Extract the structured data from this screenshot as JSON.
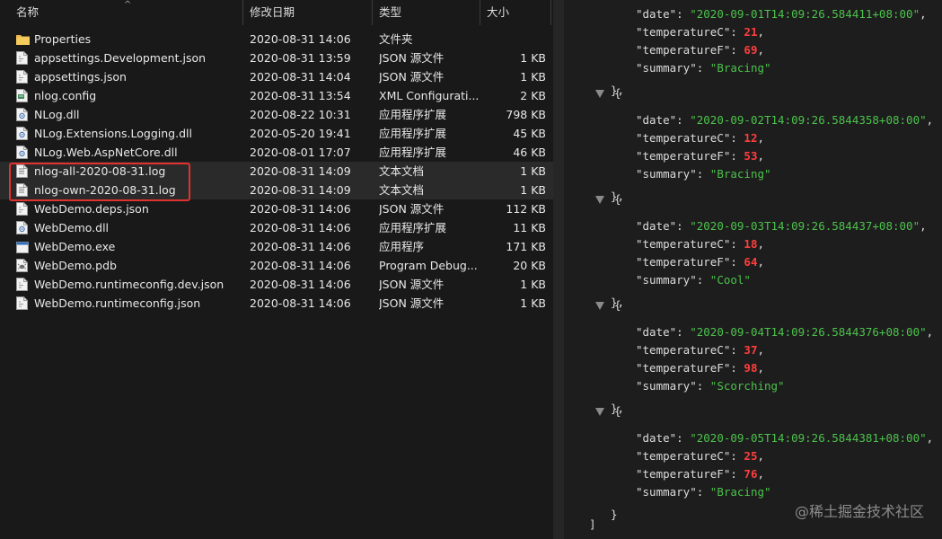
{
  "explorer": {
    "columns": {
      "name": "名称",
      "date": "修改日期",
      "type": "类型",
      "size": "大小"
    },
    "files": [
      {
        "name": "Properties",
        "date": "2020-08-31 14:06",
        "type": "文件夹",
        "size": "",
        "icon": "folder-icon"
      },
      {
        "name": "appsettings.Development.json",
        "date": "2020-08-31 13:59",
        "type": "JSON 源文件",
        "size": "1 KB",
        "icon": "json-file-icon"
      },
      {
        "name": "appsettings.json",
        "date": "2020-08-31 14:04",
        "type": "JSON 源文件",
        "size": "1 KB",
        "icon": "json-file-icon"
      },
      {
        "name": "nlog.config",
        "date": "2020-08-31 13:54",
        "type": "XML Configurati...",
        "size": "2 KB",
        "icon": "config-file-icon"
      },
      {
        "name": "NLog.dll",
        "date": "2020-08-22 10:31",
        "type": "应用程序扩展",
        "size": "798 KB",
        "icon": "dll-file-icon"
      },
      {
        "name": "NLog.Extensions.Logging.dll",
        "date": "2020-05-20 19:41",
        "type": "应用程序扩展",
        "size": "45 KB",
        "icon": "dll-file-icon"
      },
      {
        "name": "NLog.Web.AspNetCore.dll",
        "date": "2020-08-01 17:07",
        "type": "应用程序扩展",
        "size": "46 KB",
        "icon": "dll-file-icon"
      },
      {
        "name": "nlog-all-2020-08-31.log",
        "date": "2020-08-31 14:09",
        "type": "文本文档",
        "size": "1 KB",
        "icon": "text-file-icon"
      },
      {
        "name": "nlog-own-2020-08-31.log",
        "date": "2020-08-31 14:09",
        "type": "文本文档",
        "size": "1 KB",
        "icon": "text-file-icon"
      },
      {
        "name": "WebDemo.deps.json",
        "date": "2020-08-31 14:06",
        "type": "JSON 源文件",
        "size": "112 KB",
        "icon": "json-file-icon"
      },
      {
        "name": "WebDemo.dll",
        "date": "2020-08-31 14:06",
        "type": "应用程序扩展",
        "size": "11 KB",
        "icon": "dll-file-icon"
      },
      {
        "name": "WebDemo.exe",
        "date": "2020-08-31 14:06",
        "type": "应用程序",
        "size": "171 KB",
        "icon": "exe-file-icon"
      },
      {
        "name": "WebDemo.pdb",
        "date": "2020-08-31 14:06",
        "type": "Program Debug...",
        "size": "20 KB",
        "icon": "pdb-file-icon"
      },
      {
        "name": "WebDemo.runtimeconfig.dev.json",
        "date": "2020-08-31 14:06",
        "type": "JSON 源文件",
        "size": "1 KB",
        "icon": "json-file-icon"
      },
      {
        "name": "WebDemo.runtimeconfig.json",
        "date": "2020-08-31 14:06",
        "type": "JSON 源文件",
        "size": "1 KB",
        "icon": "json-file-icon"
      }
    ]
  },
  "json_view": {
    "keys": {
      "date": "\"date\"",
      "tempC": "\"temperatureC\"",
      "tempF": "\"temperatureF\"",
      "summary": "\"summary\""
    },
    "punct": {
      "open": "{",
      "close_comma": "},",
      "close_last": "}",
      "array_close": "]"
    },
    "records": [
      {
        "date": "\"2020-09-01T14:09:26.584411+08:00\"",
        "temperatureC": "21",
        "temperatureF": "69",
        "summary": "\"Bracing\""
      },
      {
        "date": "\"2020-09-02T14:09:26.5844358+08:00\"",
        "temperatureC": "12",
        "temperatureF": "53",
        "summary": "\"Bracing\""
      },
      {
        "date": "\"2020-09-03T14:09:26.584437+08:00\"",
        "temperatureC": "18",
        "temperatureF": "64",
        "summary": "\"Cool\""
      },
      {
        "date": "\"2020-09-04T14:09:26.5844376+08:00\"",
        "temperatureC": "37",
        "temperatureF": "98",
        "summary": "\"Scorching\""
      },
      {
        "date": "\"2020-09-05T14:09:26.5844381+08:00\"",
        "temperatureC": "25",
        "temperatureF": "76",
        "summary": "\"Bracing\""
      }
    ]
  },
  "watermark": "@稀土掘金技术社区",
  "colors": {
    "highlight_box": "#e0322e",
    "json_string": "#4cc24c",
    "json_number": "#ff3d3d"
  }
}
